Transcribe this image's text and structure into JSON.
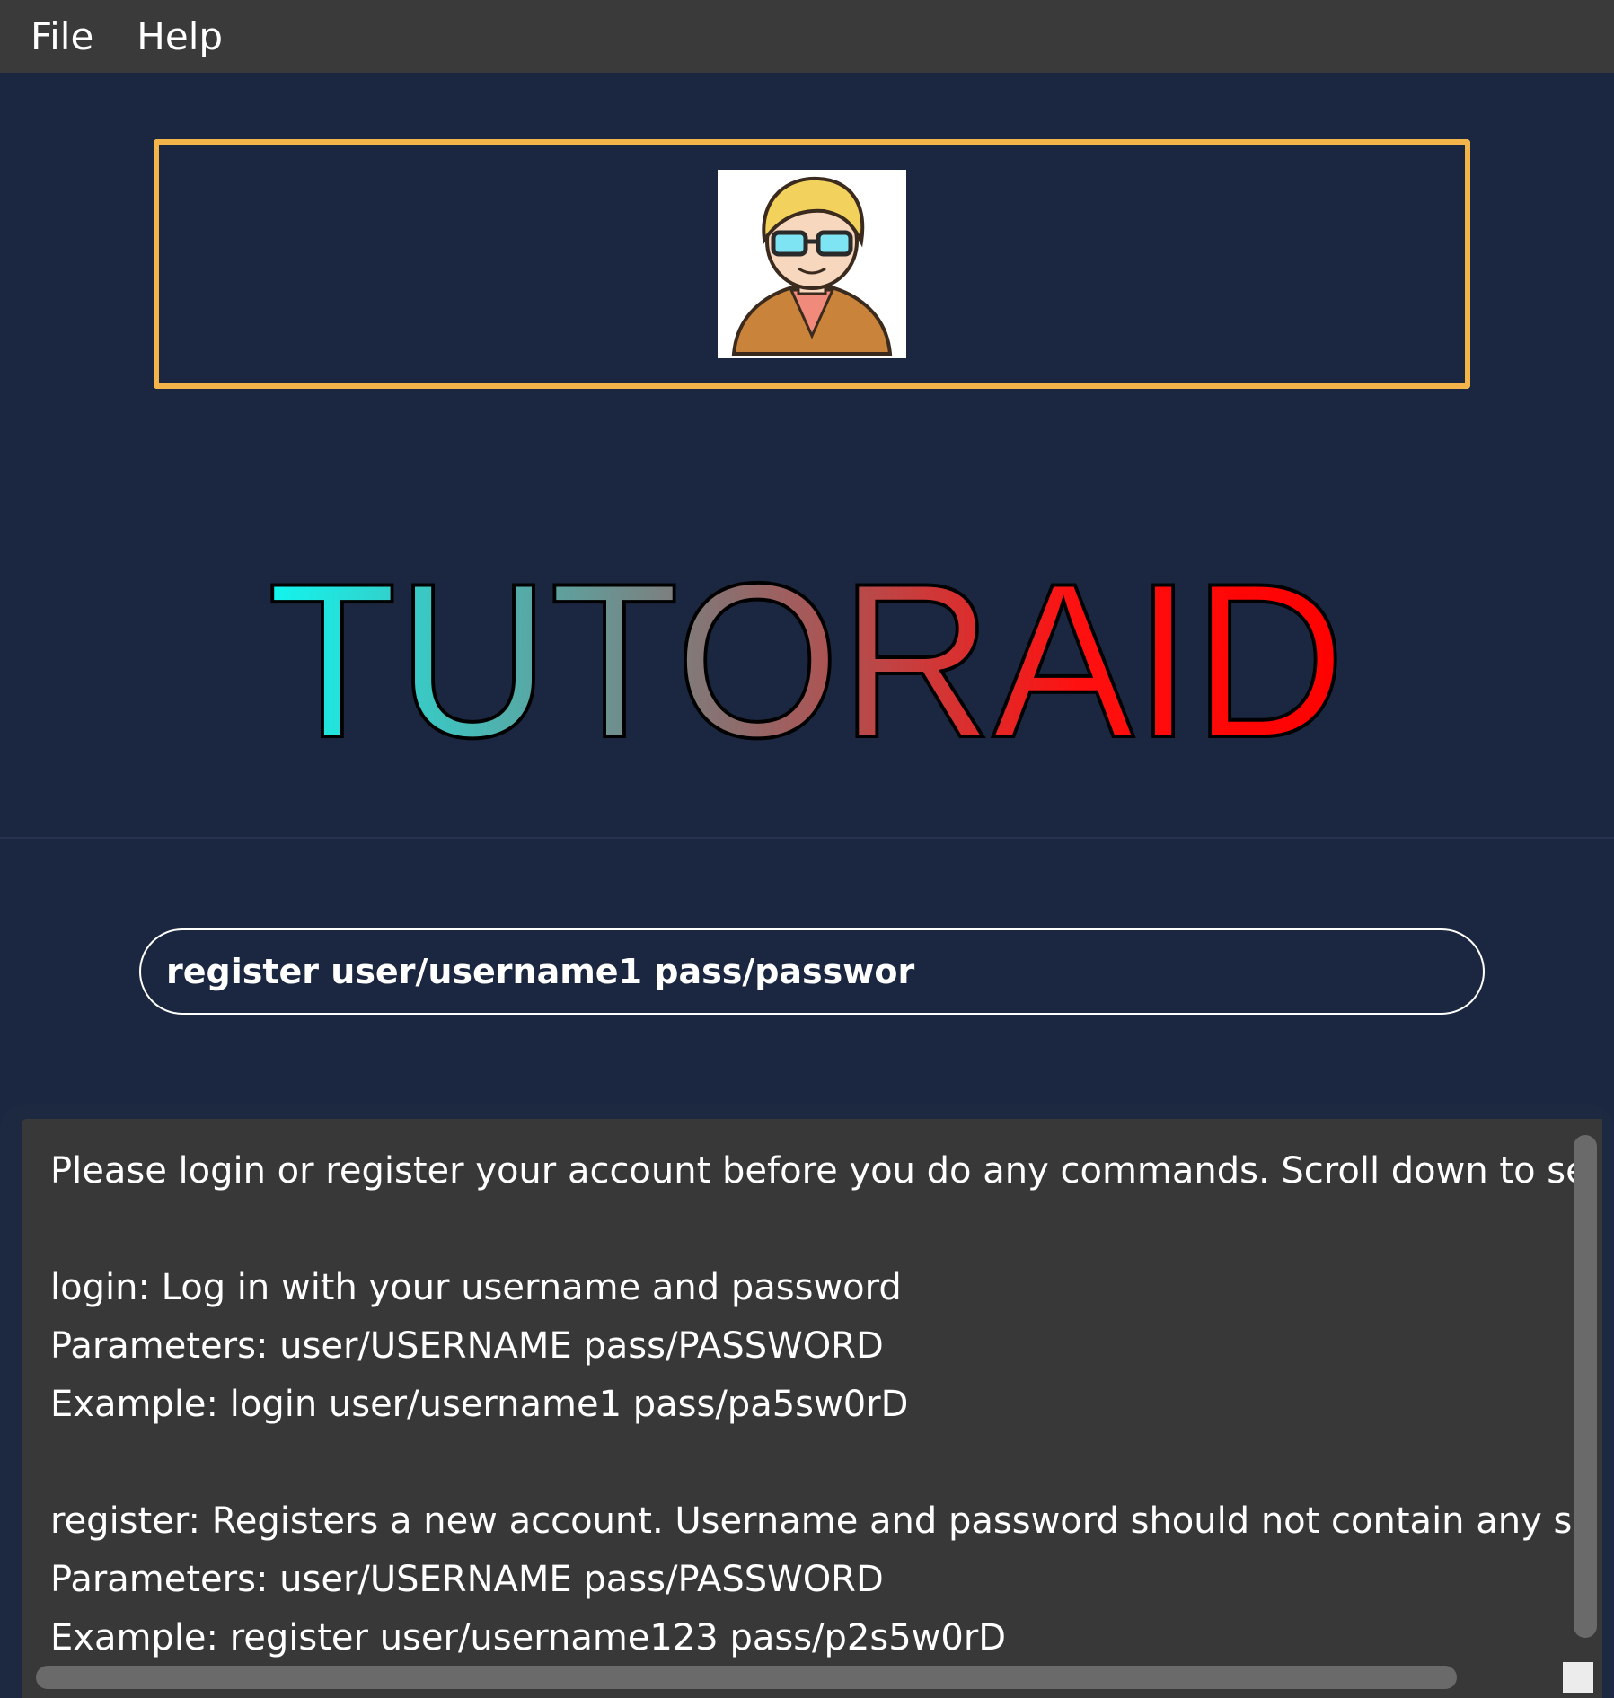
{
  "menu": {
    "file": "File",
    "help": "Help"
  },
  "logo": {
    "text": "TUTORAID",
    "gradient_start": "#12f5ee",
    "gradient_mid": "#8a7070",
    "gradient_end": "#ff0000"
  },
  "colors": {
    "background": "#1b2740",
    "menubar": "#3a3a3a",
    "avatar_border": "#f3b54a",
    "result_panel": "#383838"
  },
  "command": {
    "value": "register user/username1 pass/passwor",
    "placeholder": ""
  },
  "result": {
    "lines": [
      "Please login or register your account before you do any commands. Scroll down to see exam",
      "",
      "login: Log in with your username and password",
      "Parameters: user/USERNAME pass/PASSWORD",
      "Example: login user/username1 pass/pa5sw0rD",
      "",
      "register: Registers a new account. Username and password should not contain any spaces",
      "Parameters: user/USERNAME pass/PASSWORD",
      "Example: register user/username123 pass/p2s5w0rD"
    ]
  },
  "avatar": {
    "icon": "user-avatar-icon"
  }
}
